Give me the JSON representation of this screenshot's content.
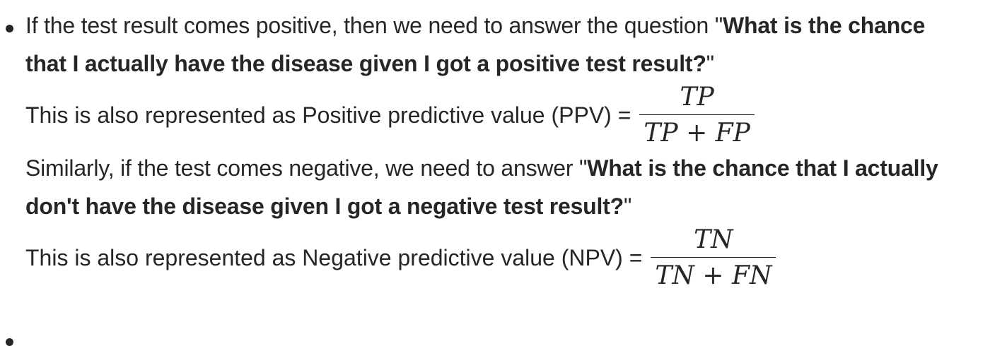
{
  "items": [
    {
      "lead_text": "If the test result comes positive, then we need to answer the question ",
      "question_open": "\"",
      "question_bold_1": "What is the chance",
      "question_bold_2": "that I actually have the disease given I got a positive test result?",
      "question_close": "\"",
      "formula_label": "This is also represented as Positive predictive value (PPV) = ",
      "numerator": "TP",
      "denominator": "TP + FP"
    },
    {
      "lead_text": "Similarly, if the test comes negative, we need to answer ",
      "question_open": "\"",
      "question_bold_1": "What is the chance that I actually",
      "question_bold_2": "don't have the disease given I got a negative test result?",
      "question_close": "\"",
      "formula_label": "This is also represented as Negative predictive value (NPV) = ",
      "numerator": "TN",
      "denominator": "TN + FN"
    }
  ]
}
